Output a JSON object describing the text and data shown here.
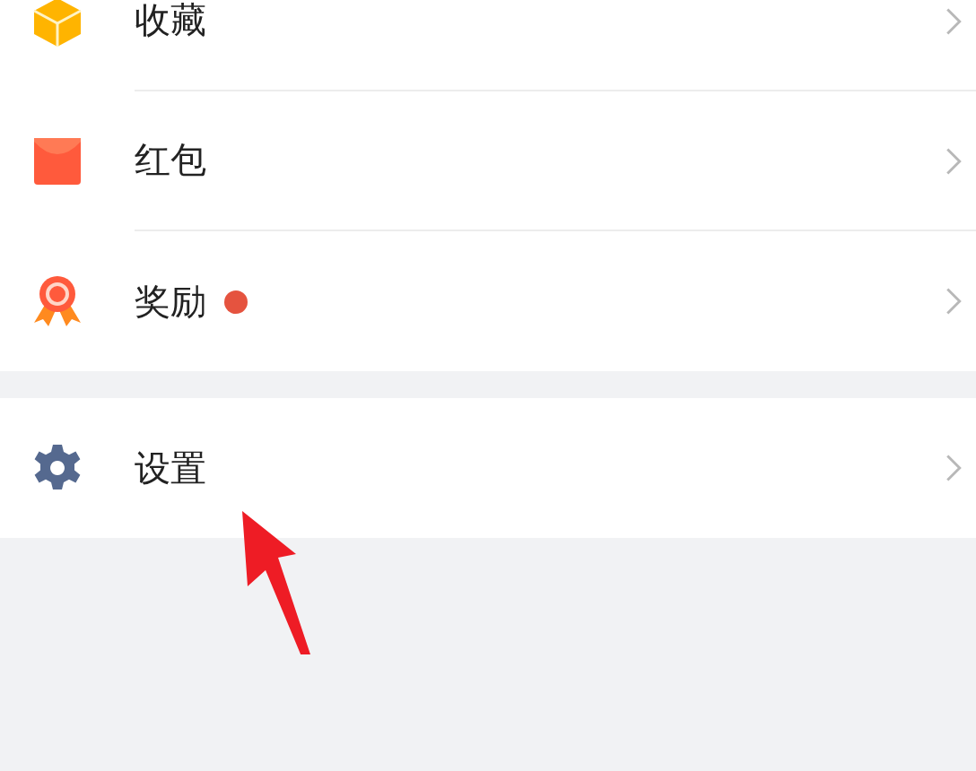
{
  "sections": [
    {
      "items": [
        {
          "kind": "box",
          "label": "收藏",
          "dot": false
        },
        {
          "kind": "envelope",
          "label": "红包",
          "dot": false
        },
        {
          "kind": "medal",
          "label": "奖励",
          "dot": true
        }
      ]
    },
    {
      "items": [
        {
          "kind": "gear",
          "label": "设置",
          "dot": false
        }
      ]
    }
  ]
}
